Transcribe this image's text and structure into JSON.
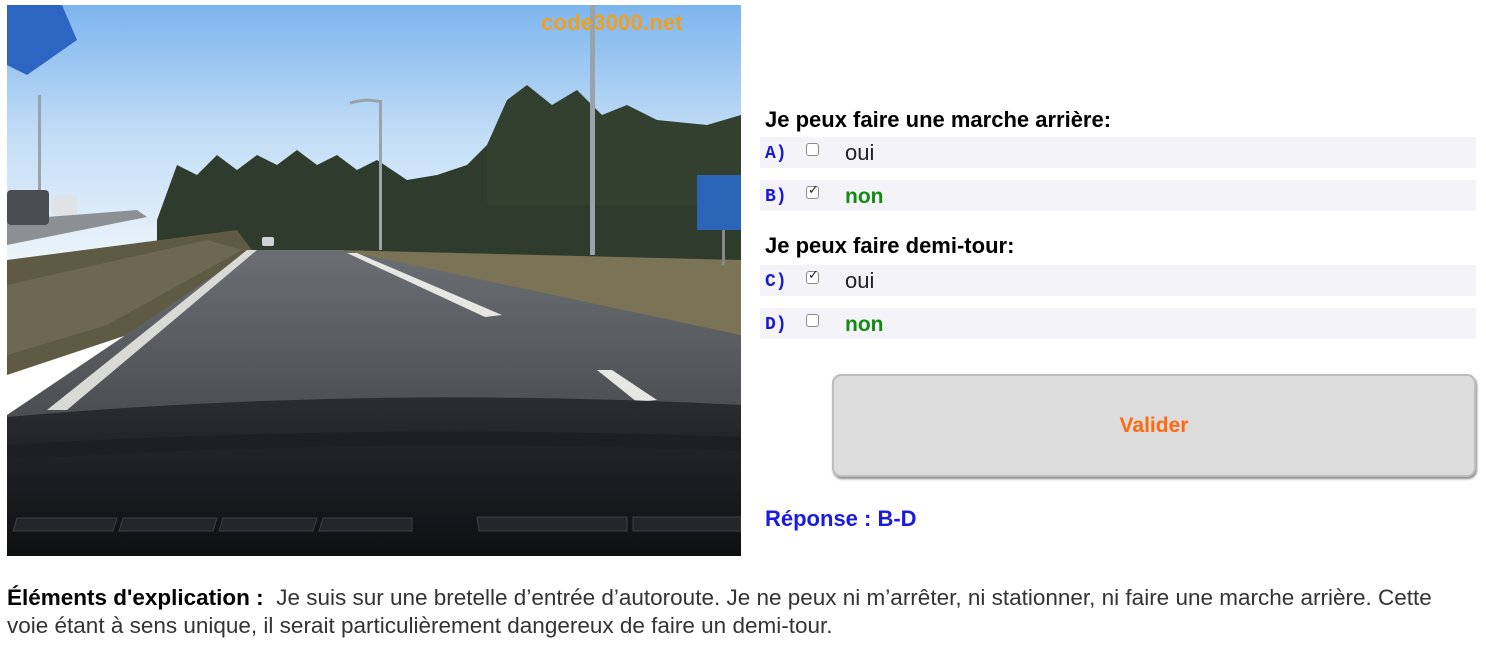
{
  "photo": {
    "watermark": "code3000.net",
    "alt": "road-view"
  },
  "question1": {
    "title": "Je peux faire une marche arrière:",
    "options": [
      {
        "letter": "A)",
        "text": "oui",
        "checked": false,
        "correct": false
      },
      {
        "letter": "B)",
        "text": "non",
        "checked": true,
        "correct": true
      }
    ]
  },
  "question2": {
    "title": "Je peux faire demi-tour:",
    "options": [
      {
        "letter": "C)",
        "text": "oui",
        "checked": true,
        "correct": false
      },
      {
        "letter": "D)",
        "text": "non",
        "checked": false,
        "correct": true
      }
    ]
  },
  "validate_label": "Valider",
  "answer": "Réponse : B-D",
  "explanation": {
    "lead": "Éléments d'explication :",
    "text": "Je suis sur une bretelle d’entrée d’autoroute. Je ne peux ni m’arrêter, ni stationner, ni faire une marche arrière. Cette voie étant à sens unique, il serait particulièrement dangereux de faire un demi-tour."
  },
  "colors": {
    "letter": "#1a1ad0",
    "correct": "#138a13",
    "button_text": "#ff6a10",
    "answer": "#1a1ae0",
    "watermark": "#f0a020"
  }
}
